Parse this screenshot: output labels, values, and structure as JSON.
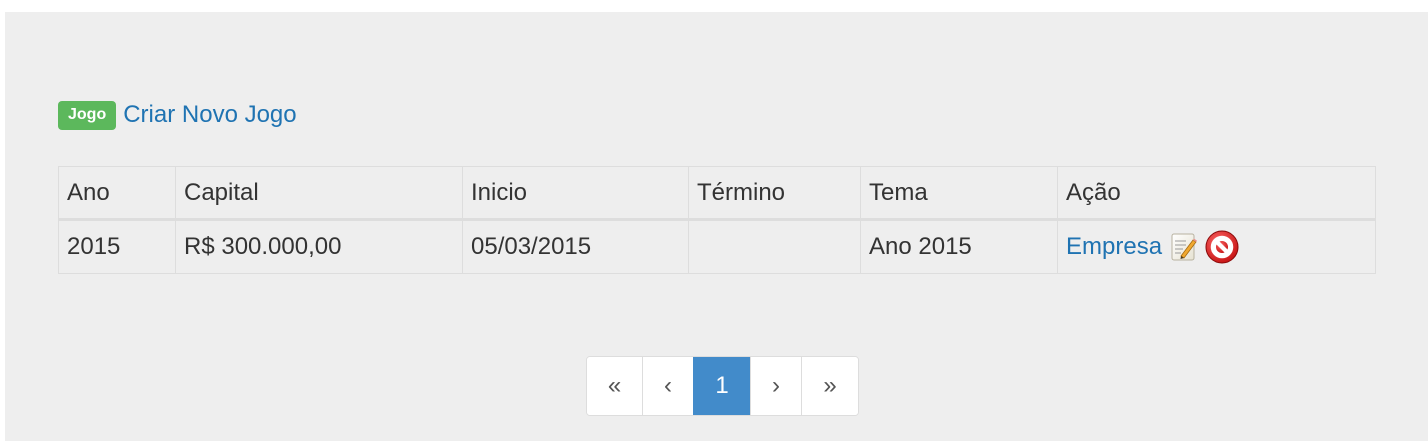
{
  "header": {
    "badge": "Jogo",
    "create_link": "Criar Novo Jogo"
  },
  "table": {
    "columns": [
      "Ano",
      "Capital",
      "Inicio",
      "Término",
      "Tema",
      "Ação"
    ],
    "rows": [
      {
        "ano": "2015",
        "capital": "R$ 300.000,00",
        "inicio": "05/03/2015",
        "termino": "",
        "tema": "Ano 2015",
        "acao_link": "Empresa",
        "icons": [
          "edit-icon",
          "delete-icon"
        ]
      }
    ]
  },
  "pagination": {
    "first": "«",
    "prev": "‹",
    "current": "1",
    "next": "›",
    "last": "»"
  },
  "colors": {
    "badge": "#5cb85c",
    "link": "#1f73b2",
    "active_page": "#428bca",
    "panel_background": "#eeeeee"
  }
}
